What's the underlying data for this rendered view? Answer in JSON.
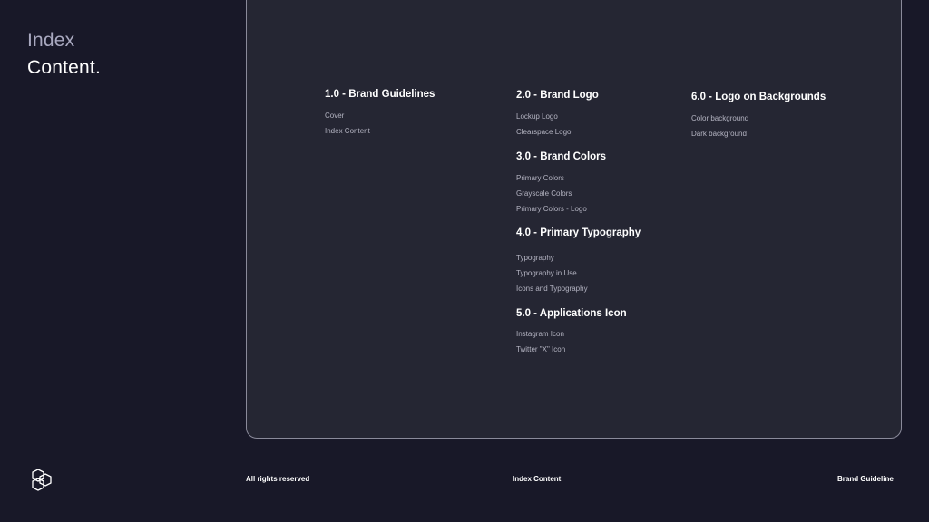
{
  "header": {
    "line1": "Index",
    "line2": "Content."
  },
  "sections": [
    {
      "heading": "1.0 - Brand Guidelines",
      "items": [
        "Cover",
        "Index Content"
      ]
    },
    {
      "heading": "2.0 - Brand Logo",
      "items": [
        "Lockup Logo",
        "Clearspace Logo"
      ]
    },
    {
      "heading": "3.0 - Brand Colors",
      "items": [
        "Primary Colors",
        "Grayscale Colors",
        "Primary Colors - Logo"
      ]
    },
    {
      "heading": "4.0 - Primary Typography",
      "items": [
        "Typography",
        "Typography in Use",
        "Icons and Typography"
      ]
    },
    {
      "heading": "5.0 - Applications Icon",
      "items": [
        "Instagram Icon",
        "Twitter \"X\"  Icon"
      ]
    },
    {
      "heading": "6.0 - Logo on Backgrounds",
      "items": [
        "Color background",
        "Dark background"
      ]
    }
  ],
  "footer": {
    "left": "All rights reserved",
    "center": "Index Content",
    "right": "Brand Guideline"
  },
  "icons": {
    "logo": "hexagon-knot-logo-icon"
  },
  "colors": {
    "background": "#181828",
    "panel": "#252633",
    "panel_border": "#8a8a9a",
    "muted_text": "#b4b4c2",
    "index_text": "#a9a9c0"
  }
}
